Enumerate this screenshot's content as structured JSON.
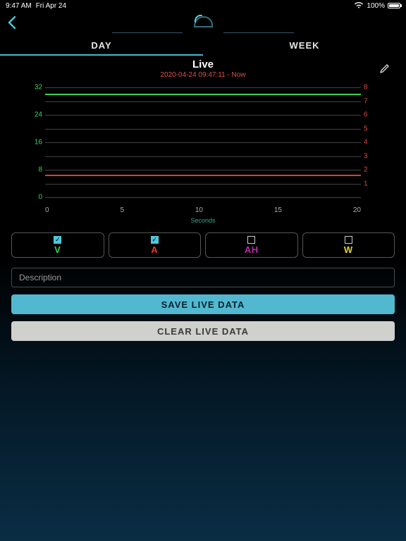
{
  "status": {
    "time": "9:47 AM",
    "date": "Fri Apr 24",
    "battery_pct": "100%"
  },
  "tabs": {
    "day": "DAY",
    "week": "WEEK",
    "active": "day"
  },
  "live": {
    "title": "Live",
    "timestamp": "2020-04-24 09:47:11 - Now"
  },
  "legend": {
    "v": {
      "label": "V",
      "checked": true
    },
    "a": {
      "label": "A",
      "checked": true
    },
    "ah": {
      "label": "AH",
      "checked": false
    },
    "w": {
      "label": "W",
      "checked": false
    }
  },
  "form": {
    "description_placeholder": "Description",
    "save_label": "SAVE LIVE DATA",
    "clear_label": "CLEAR LIVE DATA"
  },
  "chart_data": {
    "type": "line",
    "xlabel": "Seconds",
    "x_ticks": [
      "0",
      "5",
      "10",
      "15",
      "20"
    ],
    "xlim": [
      0,
      20
    ],
    "left_axis": {
      "label": "V",
      "ticks": [
        0,
        8,
        16,
        24,
        32
      ],
      "lim": [
        0,
        32
      ],
      "color": "#3cd665"
    },
    "right_axis": {
      "label": "A",
      "ticks": [
        1,
        2,
        3,
        4,
        5,
        6,
        7,
        8
      ],
      "lim": [
        0,
        8
      ],
      "color": "#d94a43"
    },
    "series": [
      {
        "name": "V",
        "axis": "left",
        "color": "#39d24e",
        "x": [
          0,
          20
        ],
        "values": [
          30,
          30
        ]
      },
      {
        "name": "A",
        "axis": "right",
        "color": "#e23c33",
        "x": [
          0,
          20
        ],
        "values": [
          1.6,
          1.6
        ]
      }
    ]
  }
}
